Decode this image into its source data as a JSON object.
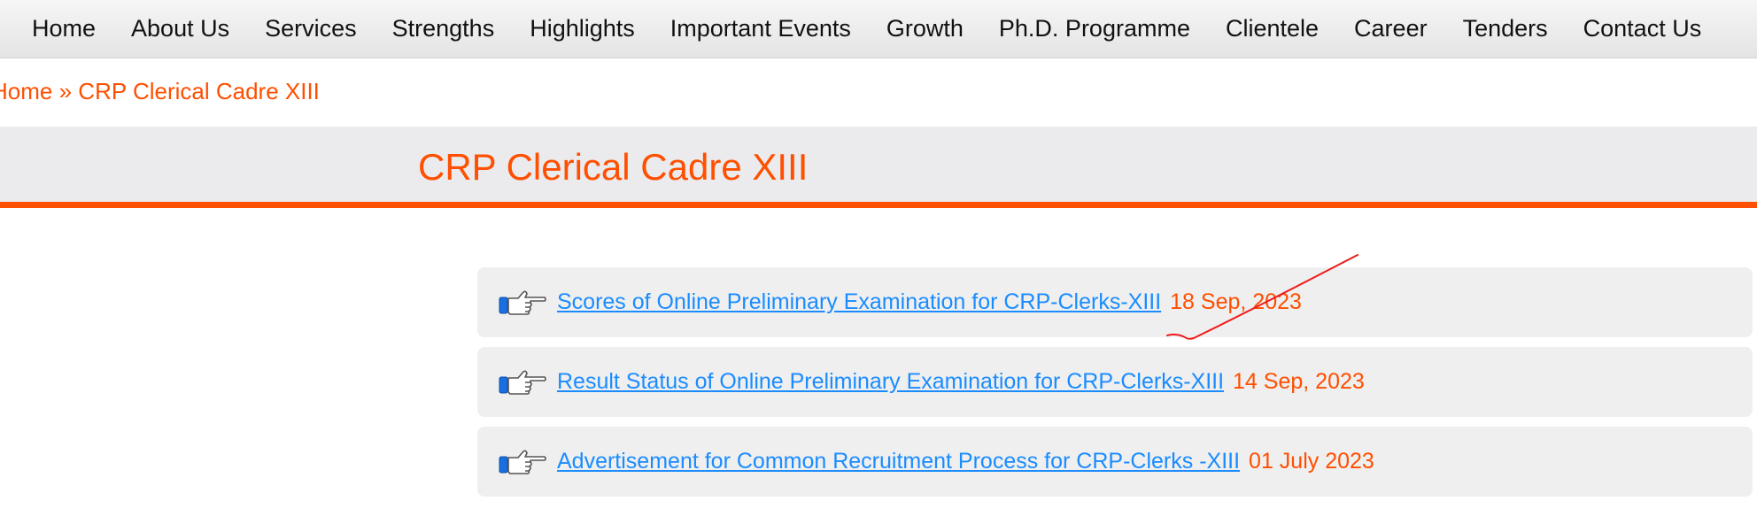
{
  "nav": {
    "items": [
      {
        "label": "Home"
      },
      {
        "label": "About Us"
      },
      {
        "label": "Services"
      },
      {
        "label": "Strengths"
      },
      {
        "label": "Highlights"
      },
      {
        "label": "Important Events"
      },
      {
        "label": "Growth"
      },
      {
        "label": "Ph.D. Programme"
      },
      {
        "label": "Clientele"
      },
      {
        "label": "Career"
      },
      {
        "label": "Tenders"
      },
      {
        "label": "Contact Us"
      }
    ]
  },
  "breadcrumb": {
    "home": "Home",
    "separator": "»",
    "current": "CRP Clerical Cadre XIII"
  },
  "page": {
    "title": "CRP Clerical Cadre XIII"
  },
  "links": [
    {
      "text": "Scores of Online Preliminary Examination for CRP-Clerks-XIII",
      "date": "18 Sep, 2023",
      "icon": "pointing-hand-icon"
    },
    {
      "text": "Result Status of Online Preliminary Examination for CRP-Clerks-XIII",
      "date": "14 Sep, 2023",
      "icon": "pointing-hand-icon"
    },
    {
      "text": "Advertisement for Common Recruitment Process for CRP-Clerks -XIII",
      "date": "01 July 2023",
      "icon": "pointing-hand-icon"
    }
  ],
  "colors": {
    "accent": "#ff4f00",
    "link": "#1a8cff",
    "nav_text": "#111111",
    "title_band": "#ebebee",
    "item_bg": "#efefef"
  }
}
